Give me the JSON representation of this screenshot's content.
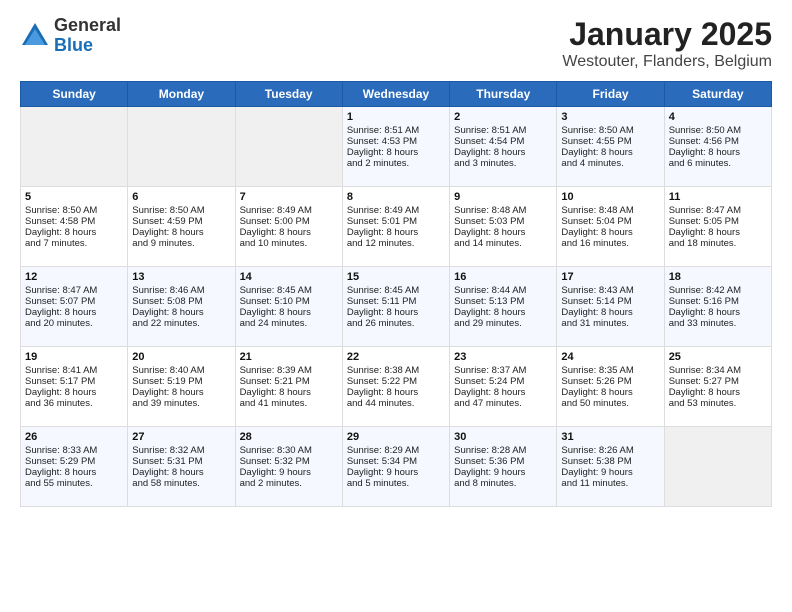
{
  "header": {
    "logo_general": "General",
    "logo_blue": "Blue",
    "title": "January 2025",
    "subtitle": "Westouter, Flanders, Belgium"
  },
  "days_of_week": [
    "Sunday",
    "Monday",
    "Tuesday",
    "Wednesday",
    "Thursday",
    "Friday",
    "Saturday"
  ],
  "weeks": [
    [
      {
        "day": "",
        "info": ""
      },
      {
        "day": "",
        "info": ""
      },
      {
        "day": "",
        "info": ""
      },
      {
        "day": "1",
        "info": "Sunrise: 8:51 AM\nSunset: 4:53 PM\nDaylight: 8 hours\nand 2 minutes."
      },
      {
        "day": "2",
        "info": "Sunrise: 8:51 AM\nSunset: 4:54 PM\nDaylight: 8 hours\nand 3 minutes."
      },
      {
        "day": "3",
        "info": "Sunrise: 8:50 AM\nSunset: 4:55 PM\nDaylight: 8 hours\nand 4 minutes."
      },
      {
        "day": "4",
        "info": "Sunrise: 8:50 AM\nSunset: 4:56 PM\nDaylight: 8 hours\nand 6 minutes."
      }
    ],
    [
      {
        "day": "5",
        "info": "Sunrise: 8:50 AM\nSunset: 4:58 PM\nDaylight: 8 hours\nand 7 minutes."
      },
      {
        "day": "6",
        "info": "Sunrise: 8:50 AM\nSunset: 4:59 PM\nDaylight: 8 hours\nand 9 minutes."
      },
      {
        "day": "7",
        "info": "Sunrise: 8:49 AM\nSunset: 5:00 PM\nDaylight: 8 hours\nand 10 minutes."
      },
      {
        "day": "8",
        "info": "Sunrise: 8:49 AM\nSunset: 5:01 PM\nDaylight: 8 hours\nand 12 minutes."
      },
      {
        "day": "9",
        "info": "Sunrise: 8:48 AM\nSunset: 5:03 PM\nDaylight: 8 hours\nand 14 minutes."
      },
      {
        "day": "10",
        "info": "Sunrise: 8:48 AM\nSunset: 5:04 PM\nDaylight: 8 hours\nand 16 minutes."
      },
      {
        "day": "11",
        "info": "Sunrise: 8:47 AM\nSunset: 5:05 PM\nDaylight: 8 hours\nand 18 minutes."
      }
    ],
    [
      {
        "day": "12",
        "info": "Sunrise: 8:47 AM\nSunset: 5:07 PM\nDaylight: 8 hours\nand 20 minutes."
      },
      {
        "day": "13",
        "info": "Sunrise: 8:46 AM\nSunset: 5:08 PM\nDaylight: 8 hours\nand 22 minutes."
      },
      {
        "day": "14",
        "info": "Sunrise: 8:45 AM\nSunset: 5:10 PM\nDaylight: 8 hours\nand 24 minutes."
      },
      {
        "day": "15",
        "info": "Sunrise: 8:45 AM\nSunset: 5:11 PM\nDaylight: 8 hours\nand 26 minutes."
      },
      {
        "day": "16",
        "info": "Sunrise: 8:44 AM\nSunset: 5:13 PM\nDaylight: 8 hours\nand 29 minutes."
      },
      {
        "day": "17",
        "info": "Sunrise: 8:43 AM\nSunset: 5:14 PM\nDaylight: 8 hours\nand 31 minutes."
      },
      {
        "day": "18",
        "info": "Sunrise: 8:42 AM\nSunset: 5:16 PM\nDaylight: 8 hours\nand 33 minutes."
      }
    ],
    [
      {
        "day": "19",
        "info": "Sunrise: 8:41 AM\nSunset: 5:17 PM\nDaylight: 8 hours\nand 36 minutes."
      },
      {
        "day": "20",
        "info": "Sunrise: 8:40 AM\nSunset: 5:19 PM\nDaylight: 8 hours\nand 39 minutes."
      },
      {
        "day": "21",
        "info": "Sunrise: 8:39 AM\nSunset: 5:21 PM\nDaylight: 8 hours\nand 41 minutes."
      },
      {
        "day": "22",
        "info": "Sunrise: 8:38 AM\nSunset: 5:22 PM\nDaylight: 8 hours\nand 44 minutes."
      },
      {
        "day": "23",
        "info": "Sunrise: 8:37 AM\nSunset: 5:24 PM\nDaylight: 8 hours\nand 47 minutes."
      },
      {
        "day": "24",
        "info": "Sunrise: 8:35 AM\nSunset: 5:26 PM\nDaylight: 8 hours\nand 50 minutes."
      },
      {
        "day": "25",
        "info": "Sunrise: 8:34 AM\nSunset: 5:27 PM\nDaylight: 8 hours\nand 53 minutes."
      }
    ],
    [
      {
        "day": "26",
        "info": "Sunrise: 8:33 AM\nSunset: 5:29 PM\nDaylight: 8 hours\nand 55 minutes."
      },
      {
        "day": "27",
        "info": "Sunrise: 8:32 AM\nSunset: 5:31 PM\nDaylight: 8 hours\nand 58 minutes."
      },
      {
        "day": "28",
        "info": "Sunrise: 8:30 AM\nSunset: 5:32 PM\nDaylight: 9 hours\nand 2 minutes."
      },
      {
        "day": "29",
        "info": "Sunrise: 8:29 AM\nSunset: 5:34 PM\nDaylight: 9 hours\nand 5 minutes."
      },
      {
        "day": "30",
        "info": "Sunrise: 8:28 AM\nSunset: 5:36 PM\nDaylight: 9 hours\nand 8 minutes."
      },
      {
        "day": "31",
        "info": "Sunrise: 8:26 AM\nSunset: 5:38 PM\nDaylight: 9 hours\nand 11 minutes."
      },
      {
        "day": "",
        "info": ""
      }
    ]
  ]
}
